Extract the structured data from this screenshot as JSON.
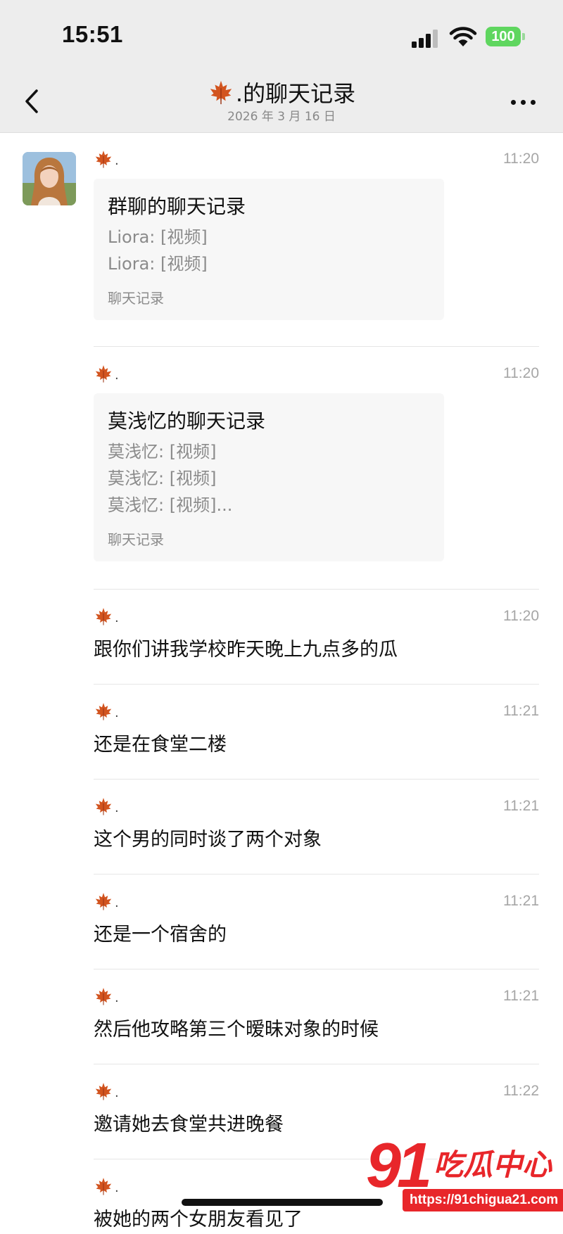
{
  "status_bar": {
    "time": "15:51",
    "battery": "100",
    "battery_color": "#5fd65f"
  },
  "nav": {
    "title_suffix": ".的聊天记录",
    "subtitle": "2026 年 3 月 16 日",
    "title_icon": "maple-leaf-icon",
    "back_icon": "chevron-left-icon",
    "more_icon": "ellipsis-icon"
  },
  "messages": [
    {
      "sender": ".",
      "time": "11:20",
      "type": "card",
      "card": {
        "title": "群聊的聊天记录",
        "lines": [
          "Liora: [视频]",
          "Liora: [视频]"
        ],
        "footer": "聊天记录"
      }
    },
    {
      "sender": ".",
      "time": "11:20",
      "type": "card",
      "card": {
        "title": "莫浅忆的聊天记录",
        "lines": [
          "莫浅忆: [视频]",
          "莫浅忆: [视频]",
          "莫浅忆: [视频]..."
        ],
        "footer": "聊天记录"
      }
    },
    {
      "sender": ".",
      "time": "11:20",
      "type": "text",
      "text": "跟你们讲我学校昨天晚上九点多的瓜"
    },
    {
      "sender": ".",
      "time": "11:21",
      "type": "text",
      "text": "还是在食堂二楼"
    },
    {
      "sender": ".",
      "time": "11:21",
      "type": "text",
      "text": "这个男的同时谈了两个对象"
    },
    {
      "sender": ".",
      "time": "11:21",
      "type": "text",
      "text": "还是一个宿舍的"
    },
    {
      "sender": ".",
      "time": "11:21",
      "type": "text",
      "text": "然后他攻略第三个暧昧对象的时候"
    },
    {
      "sender": ".",
      "time": "11:22",
      "type": "text",
      "text": "邀请她去食堂共进晚餐"
    },
    {
      "sender": ".",
      "time": "",
      "type": "text",
      "text": "被她的两个女朋友看见了"
    }
  ],
  "watermark": {
    "number": "91",
    "text": "吃瓜中心",
    "url": "https://91chigua21.com"
  }
}
